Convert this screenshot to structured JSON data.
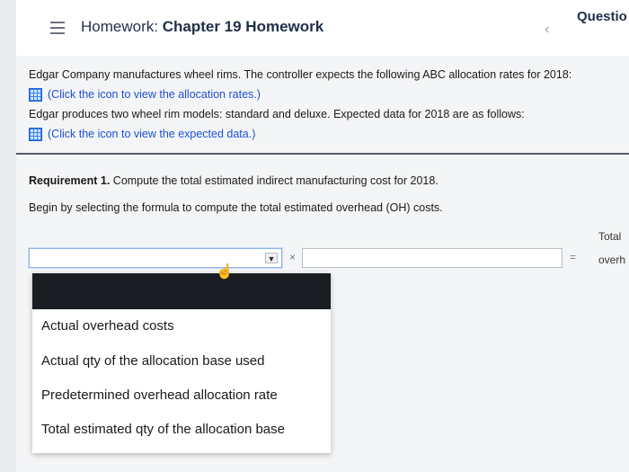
{
  "header": {
    "title_prefix": "Homework:",
    "title_main": "Chapter 19 Homework",
    "question_label": "Questio"
  },
  "intro": {
    "line1": "Edgar Company manufactures wheel rims. The controller  expects the following ABC allocation rates for 2018:",
    "link1": "(Click the icon to view the allocation rates.)",
    "line2": "Edgar produces two wheel rim models: standard and deluxe. Expected data for 2018 are as follows:",
    "link2": "(Click the icon to view the expected data.)"
  },
  "requirement": {
    "label": "Requirement 1.",
    "text": " Compute the total estimated indirect manufacturing cost for 2018.",
    "instruction": "Begin by selecting the formula to compute the total estimated overhead (OH) costs."
  },
  "formula": {
    "column_header_line1": "Total",
    "column_header_line2": "overh",
    "operator_times": "×",
    "operator_equals": "=",
    "selected_value": ""
  },
  "dropdown": {
    "options": [
      "Actual overhead costs",
      "Actual qty of the allocation base used",
      "Predetermined overhead allocation rate",
      "Total estimated qty of the allocation base"
    ]
  },
  "colors": {
    "title": "#1f2f4a",
    "link": "#1d4ed8",
    "icon": "#3b82f6",
    "dropdown_header": "#1a1d22"
  }
}
